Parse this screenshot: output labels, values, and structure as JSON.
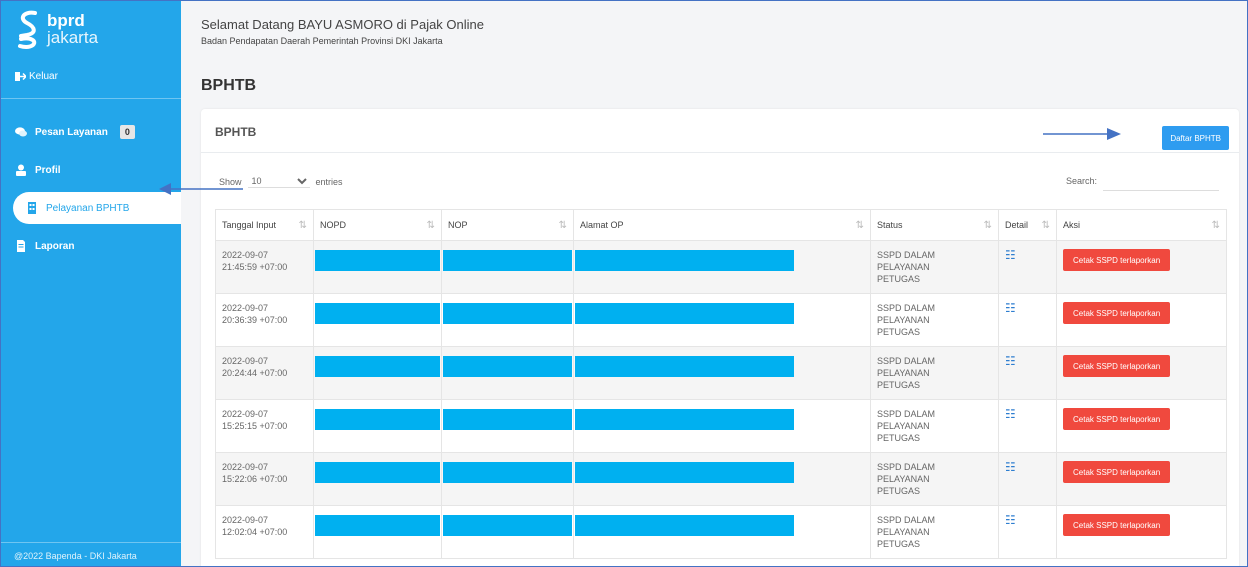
{
  "sidebar": {
    "logo_top": "bprd",
    "logo_bottom": "jakarta",
    "logout_label": "Keluar",
    "items": [
      {
        "label": "Pesan Layanan",
        "badge": "0"
      },
      {
        "label": "Profil"
      },
      {
        "label": "Pelayanan BPHTB",
        "active": true
      },
      {
        "label": "Laporan"
      }
    ],
    "footer": "@2022 Bapenda - DKI Jakarta"
  },
  "header": {
    "welcome": "Selamat Datang BAYU ASMORO di Pajak Online",
    "subtitle": "Badan Pendapatan Daerah Pemerintah Provinsi DKI Jakarta",
    "page_title": "BPHTB"
  },
  "card": {
    "title": "BPHTB",
    "daftar_button": "Daftar BPHTB",
    "show_label": "Show",
    "show_value": "10",
    "entries_label": "entries",
    "search_label": "Search:",
    "columns": [
      "Tanggal Input",
      "NOPD",
      "NOP",
      "Alamat OP",
      "Status",
      "Detail",
      "Aksi"
    ],
    "rows": [
      {
        "date": "2022-09-07",
        "time": "21:45:59 +07:00",
        "status": [
          "SSPD DALAM",
          "PELAYANAN",
          "PETUGAS"
        ],
        "action": "Cetak SSPD terlaporkan"
      },
      {
        "date": "2022-09-07",
        "time": "20:36:39 +07:00",
        "status": [
          "SSPD DALAM",
          "PELAYANAN",
          "PETUGAS"
        ],
        "action": "Cetak SSPD terlaporkan"
      },
      {
        "date": "2022-09-07",
        "time": "20:24:44 +07:00",
        "status": [
          "SSPD DALAM",
          "PELAYANAN",
          "PETUGAS"
        ],
        "action": "Cetak SSPD terlaporkan"
      },
      {
        "date": "2022-09-07",
        "time": "15:25:15 +07:00",
        "status": [
          "SSPD DALAM",
          "PELAYANAN",
          "PETUGAS"
        ],
        "action": "Cetak SSPD terlaporkan"
      },
      {
        "date": "2022-09-07",
        "time": "15:22:06 +07:00",
        "status": [
          "SSPD DALAM",
          "PELAYANAN",
          "PETUGAS"
        ],
        "action": "Cetak SSPD terlaporkan"
      },
      {
        "date": "2022-09-07",
        "time": "12:02:04 +07:00",
        "status": [
          "SSPD DALAM",
          "PELAYANAN",
          "PETUGAS"
        ],
        "action": "Cetak SSPD terlaporkan"
      }
    ]
  },
  "colors": {
    "sidebar": "#23a6ea",
    "redaction": "#00b0f0",
    "action_button": "#f0493e",
    "primary_button": "#2e9cf0",
    "annotation_arrow": "#4472c4"
  }
}
